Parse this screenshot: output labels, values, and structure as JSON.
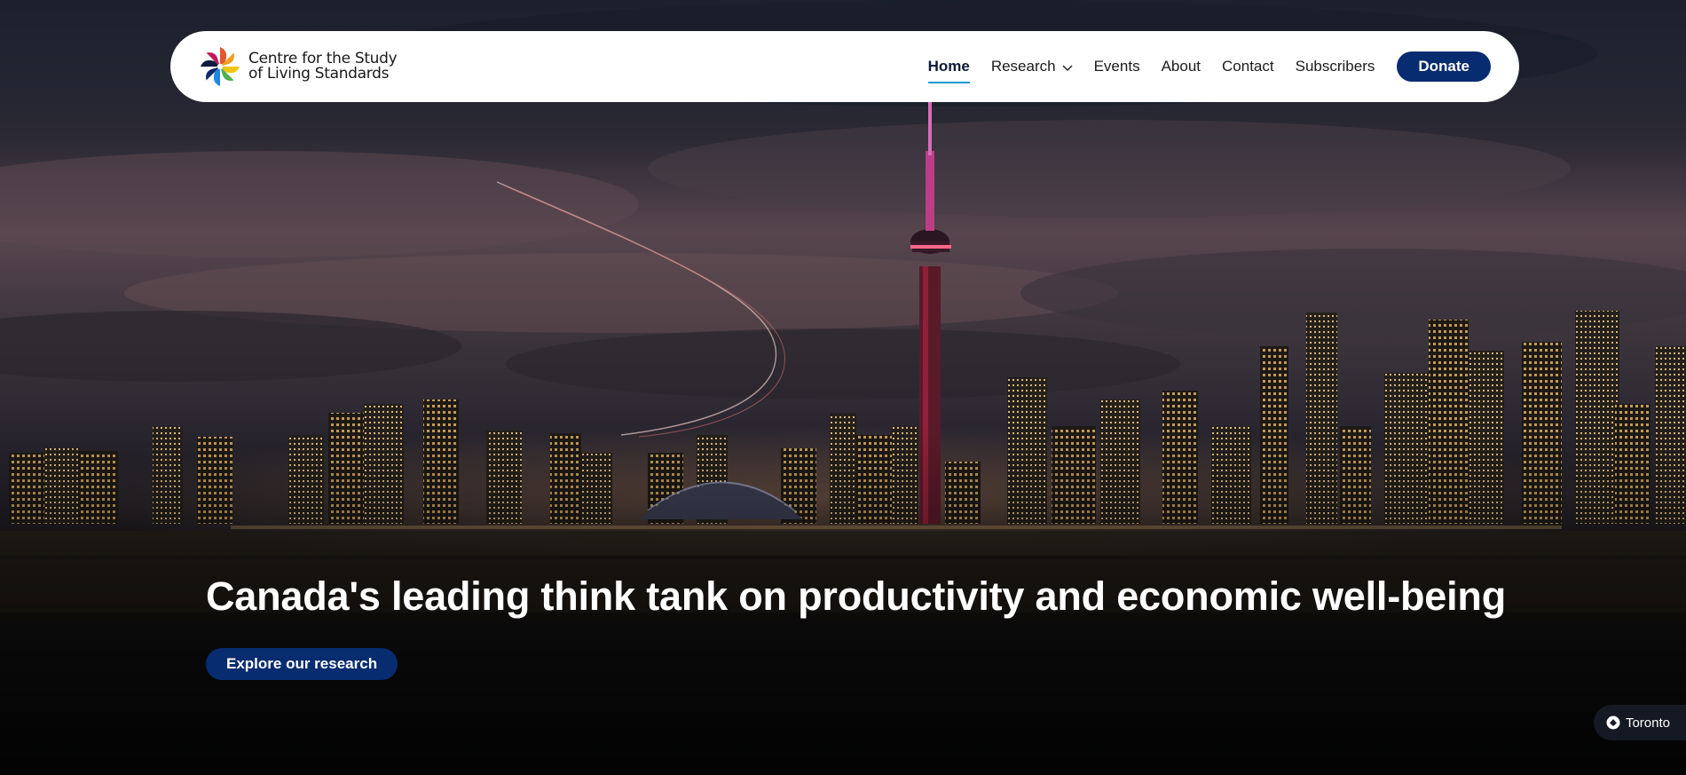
{
  "brand": {
    "name_line1": "Centre for the Study",
    "name_line2": "of Living Standards",
    "logo_icon": "pinwheel-logo"
  },
  "nav": {
    "items": [
      {
        "label": "Home",
        "active": true
      },
      {
        "label": "Research",
        "has_dropdown": true
      },
      {
        "label": "Events"
      },
      {
        "label": "About"
      },
      {
        "label": "Contact"
      },
      {
        "label": "Subscribers"
      }
    ],
    "donate_label": "Donate"
  },
  "hero": {
    "headline": "Canada's leading think tank on productivity and economic well-being",
    "cta_label": "Explore our research",
    "location_label": "Toronto",
    "location_icon": "location-circle-icon"
  },
  "colors": {
    "primary": "#072c70",
    "active_underline": "#1a9bd6",
    "navbar_bg": "#ffffff",
    "text_on_dark": "#ffffff"
  }
}
